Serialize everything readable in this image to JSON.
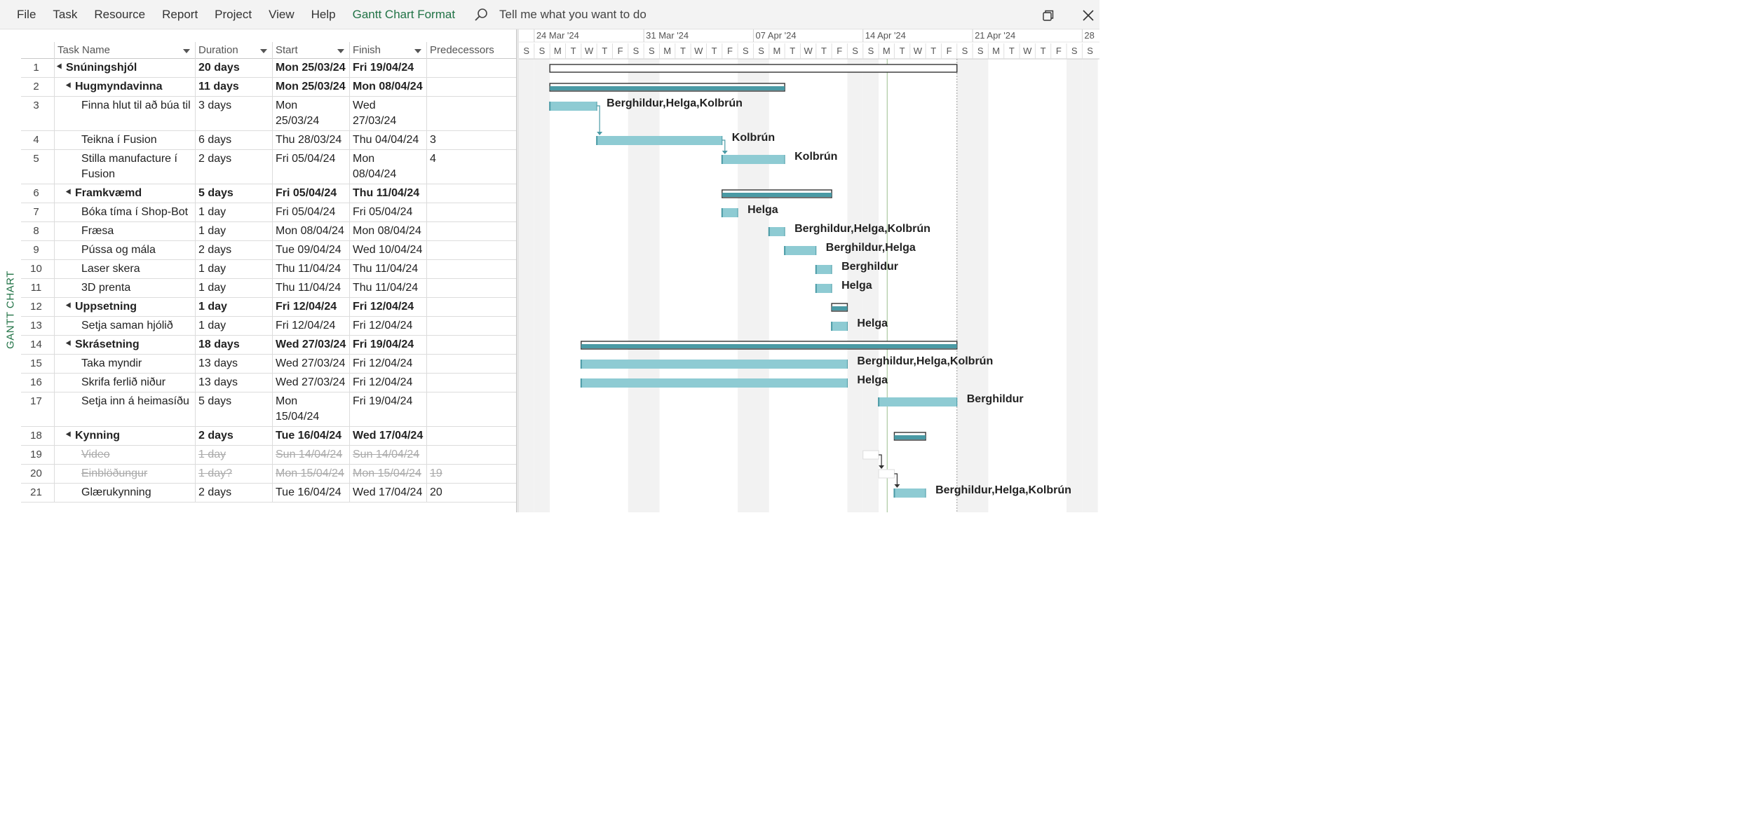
{
  "menu": {
    "items": [
      "File",
      "Task",
      "Resource",
      "Report",
      "Project",
      "View",
      "Help",
      "Gantt Chart Format"
    ],
    "active": "Gantt Chart Format",
    "tell_me": "Tell me what you want to do"
  },
  "side_label": "GANTT CHART",
  "columns": {
    "name": "Task Name",
    "duration": "Duration",
    "start": "Start",
    "finish": "Finish",
    "predecessors": "Predecessors"
  },
  "timescale": {
    "weeks": [
      "24 Mar '24",
      "31 Mar '24",
      "07 Apr '24",
      "14 Apr '24",
      "21 Apr '24",
      "28"
    ],
    "day_letters": [
      "S",
      "S",
      "M",
      "T",
      "W",
      "T",
      "F",
      "S",
      "S",
      "M",
      "T",
      "W",
      "T",
      "F",
      "S",
      "S",
      "M",
      "T",
      "W",
      "T",
      "F",
      "S",
      "S",
      "M",
      "T",
      "W",
      "T",
      "F",
      "S",
      "S",
      "M",
      "T",
      "W",
      "T",
      "F",
      "S",
      "S"
    ],
    "first_day": "2024-03-23",
    "today": "2024-04-15",
    "project_finish": "2024-04-19"
  },
  "tasks": [
    {
      "id": "1",
      "name": "Snúningshjól",
      "duration": "20 days",
      "start": "Mon 25/03/24",
      "finish": "Fri 19/04/24",
      "pred": "",
      "level": 0,
      "summary": true,
      "bar_start": "2024-03-25",
      "bar_end": "2024-04-19",
      "resources": ""
    },
    {
      "id": "2",
      "name": "Hugmyndavinna",
      "duration": "11 days",
      "start": "Mon 25/03/24",
      "finish": "Mon 08/04/24",
      "pred": "",
      "level": 1,
      "summary": true,
      "bar_start": "2024-03-25",
      "bar_end": "2024-04-08",
      "resources": ""
    },
    {
      "id": "3",
      "name": "Finna hlut til að búa til",
      "duration": "3 days",
      "start": "Mon 25/03/24",
      "finish": "Wed 27/03/24",
      "pred": "",
      "level": 2,
      "tall": true,
      "bar_start": "2024-03-25",
      "bar_end": "2024-03-27",
      "resources": "Berghildur,Helga,Kolbrún"
    },
    {
      "id": "4",
      "name": "Teikna í Fusion",
      "duration": "6 days",
      "start": "Thu 28/03/24",
      "finish": "Thu 04/04/24",
      "pred": "3",
      "level": 2,
      "bar_start": "2024-03-28",
      "bar_end": "2024-04-04",
      "resources": "Kolbrún"
    },
    {
      "id": "5",
      "name": "Stilla manufacture í Fusion",
      "duration": "2 days",
      "start": "Fri 05/04/24",
      "finish": "Mon 08/04/24",
      "pred": "4",
      "level": 2,
      "tall": true,
      "bar_start": "2024-04-05",
      "bar_end": "2024-04-08",
      "resources": "Kolbrún"
    },
    {
      "id": "6",
      "name": "Framkvæmd",
      "duration": "5 days",
      "start": "Fri 05/04/24",
      "finish": "Thu 11/04/24",
      "pred": "",
      "level": 1,
      "summary": true,
      "bar_start": "2024-04-05",
      "bar_end": "2024-04-11",
      "resources": ""
    },
    {
      "id": "7",
      "name": "Bóka tíma í Shop-Bot",
      "duration": "1 day",
      "start": "Fri 05/04/24",
      "finish": "Fri 05/04/24",
      "pred": "",
      "level": 2,
      "bar_start": "2024-04-05",
      "bar_end": "2024-04-05",
      "resources": "Helga"
    },
    {
      "id": "8",
      "name": "Fræsa",
      "duration": "1 day",
      "start": "Mon 08/04/24",
      "finish": "Mon 08/04/24",
      "pred": "",
      "level": 2,
      "bar_start": "2024-04-08",
      "bar_end": "2024-04-08",
      "resources": "Berghildur,Helga,Kolbrún"
    },
    {
      "id": "9",
      "name": "Pússa og mála",
      "duration": "2 days",
      "start": "Tue 09/04/24",
      "finish": "Wed 10/04/24",
      "pred": "",
      "level": 2,
      "bar_start": "2024-04-09",
      "bar_end": "2024-04-10",
      "resources": "Berghildur,Helga"
    },
    {
      "id": "10",
      "name": "Laser skera",
      "duration": "1 day",
      "start": "Thu 11/04/24",
      "finish": "Thu 11/04/24",
      "pred": "",
      "level": 2,
      "bar_start": "2024-04-11",
      "bar_end": "2024-04-11",
      "resources": "Berghildur"
    },
    {
      "id": "11",
      "name": "3D prenta",
      "duration": "1 day",
      "start": "Thu 11/04/24",
      "finish": "Thu 11/04/24",
      "pred": "",
      "level": 2,
      "bar_start": "2024-04-11",
      "bar_end": "2024-04-11",
      "resources": "Helga"
    },
    {
      "id": "12",
      "name": "Uppsetning",
      "duration": "1 day",
      "start": "Fri 12/04/24",
      "finish": "Fri 12/04/24",
      "pred": "",
      "level": 1,
      "summary": true,
      "bar_start": "2024-04-12",
      "bar_end": "2024-04-12",
      "resources": ""
    },
    {
      "id": "13",
      "name": "Setja saman hjólið",
      "duration": "1 day",
      "start": "Fri 12/04/24",
      "finish": "Fri 12/04/24",
      "pred": "",
      "level": 2,
      "bar_start": "2024-04-12",
      "bar_end": "2024-04-12",
      "resources": "Helga"
    },
    {
      "id": "14",
      "name": "Skrásetning",
      "duration": "18 days",
      "start": "Wed 27/03/24",
      "finish": "Fri 19/04/24",
      "pred": "",
      "level": 1,
      "summary": true,
      "bar_start": "2024-03-27",
      "bar_end": "2024-04-19",
      "resources": ""
    },
    {
      "id": "15",
      "name": "Taka myndir",
      "duration": "13 days",
      "start": "Wed 27/03/24",
      "finish": "Fri 12/04/24",
      "pred": "",
      "level": 2,
      "bar_start": "2024-03-27",
      "bar_end": "2024-04-12",
      "resources": "Berghildur,Helga,Kolbrún"
    },
    {
      "id": "16",
      "name": "Skrifa ferlið niður",
      "duration": "13 days",
      "start": "Wed 27/03/24",
      "finish": "Fri 12/04/24",
      "pred": "",
      "level": 2,
      "bar_start": "2024-03-27",
      "bar_end": "2024-04-12",
      "resources": "Helga"
    },
    {
      "id": "17",
      "name": "Setja inn á heimasíðu",
      "duration": "5 days",
      "start": "Mon 15/04/24",
      "finish": "Fri 19/04/24",
      "pred": "",
      "level": 2,
      "tall": true,
      "bar_start": "2024-04-15",
      "bar_end": "2024-04-19",
      "resources": "Berghildur"
    },
    {
      "id": "18",
      "name": "Kynning",
      "duration": "2 days",
      "start": "Tue 16/04/24",
      "finish": "Wed 17/04/24",
      "pred": "",
      "level": 1,
      "summary": true,
      "bar_start": "2024-04-16",
      "bar_end": "2024-04-17",
      "resources": ""
    },
    {
      "id": "19",
      "name": "Video",
      "duration": "1 day",
      "start": "Sun 14/04/24",
      "finish": "Sun 14/04/24",
      "pred": "",
      "level": 2,
      "inactive": true,
      "bar_start": "2024-04-14",
      "bar_end": "2024-04-14",
      "resources": ""
    },
    {
      "id": "20",
      "name": "Einblöðungur",
      "duration": "1 day?",
      "start": "Mon 15/04/24",
      "finish": "Mon 15/04/24",
      "pred": "19",
      "level": 2,
      "inactive": true,
      "bar_start": "2024-04-15",
      "bar_end": "2024-04-15",
      "resources": ""
    },
    {
      "id": "21",
      "name": "Glærukynning",
      "duration": "2 days",
      "start": "Tue 16/04/24",
      "finish": "Wed 17/04/24",
      "pred": "20",
      "level": 2,
      "bar_start": "2024-04-16",
      "bar_end": "2024-04-17",
      "resources": "Berghildur,Helga,Kolbrún"
    }
  ],
  "links": [
    {
      "from": "3",
      "to": "4"
    },
    {
      "from": "4",
      "to": "5"
    },
    {
      "from": "19",
      "to": "20"
    },
    {
      "from": "20",
      "to": "21"
    }
  ],
  "colors": {
    "accent": "#217346",
    "task_bar": "#8ecbd3",
    "summary_bar": "#4a9aa5",
    "weekend_shade": "#f2f2f2"
  }
}
